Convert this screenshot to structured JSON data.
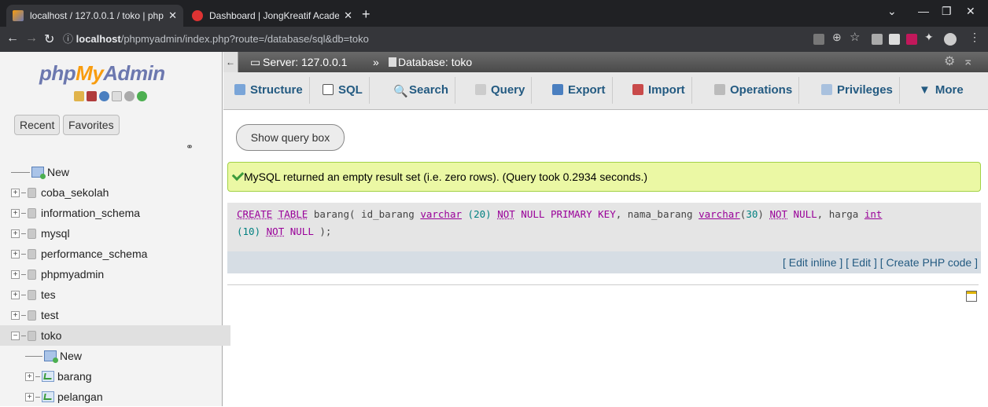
{
  "browser": {
    "tabs": [
      {
        "title": "localhost / 127.0.0.1 / toko | php",
        "active": true
      },
      {
        "title": "Dashboard | JongKreatif Academ",
        "active": false
      }
    ],
    "url_host": "localhost",
    "url_path": "/phpmyadmin/index.php?route=/database/sql&db=toko"
  },
  "sidebar": {
    "logo_php": "php",
    "logo_my": "My",
    "logo_admin": "Admin",
    "recent_label": "Recent",
    "favorites_label": "Favorites",
    "tree": [
      {
        "label": "New",
        "type": "new",
        "expanded": null
      },
      {
        "label": "coba_sekolah",
        "type": "db",
        "expanded": false
      },
      {
        "label": "information_schema",
        "type": "db",
        "expanded": false
      },
      {
        "label": "mysql",
        "type": "db",
        "expanded": false
      },
      {
        "label": "performance_schema",
        "type": "db",
        "expanded": false
      },
      {
        "label": "phpmyadmin",
        "type": "db",
        "expanded": false
      },
      {
        "label": "tes",
        "type": "db",
        "expanded": false
      },
      {
        "label": "test",
        "type": "db",
        "expanded": false
      },
      {
        "label": "toko",
        "type": "db",
        "expanded": true
      },
      {
        "label": "New",
        "type": "child-new",
        "expanded": null
      },
      {
        "label": "barang",
        "type": "table",
        "expanded": false
      },
      {
        "label": "pelangan",
        "type": "table",
        "expanded": false
      }
    ]
  },
  "breadcrumb": {
    "server": "Server: 127.0.0.1",
    "sep": "»",
    "database": "Database: toko"
  },
  "menu_tabs": [
    "Structure",
    "SQL",
    "Search",
    "Query",
    "Export",
    "Import",
    "Operations",
    "Privileges",
    "More"
  ],
  "main": {
    "show_query_box": "Show query box",
    "success_message": "MySQL returned an empty result set (i.e. zero rows). (Query took 0.2934 seconds.)",
    "edit_inline": "[ Edit inline ]",
    "edit": "[ Edit ]",
    "create_php": "[ Create PHP code ]"
  }
}
